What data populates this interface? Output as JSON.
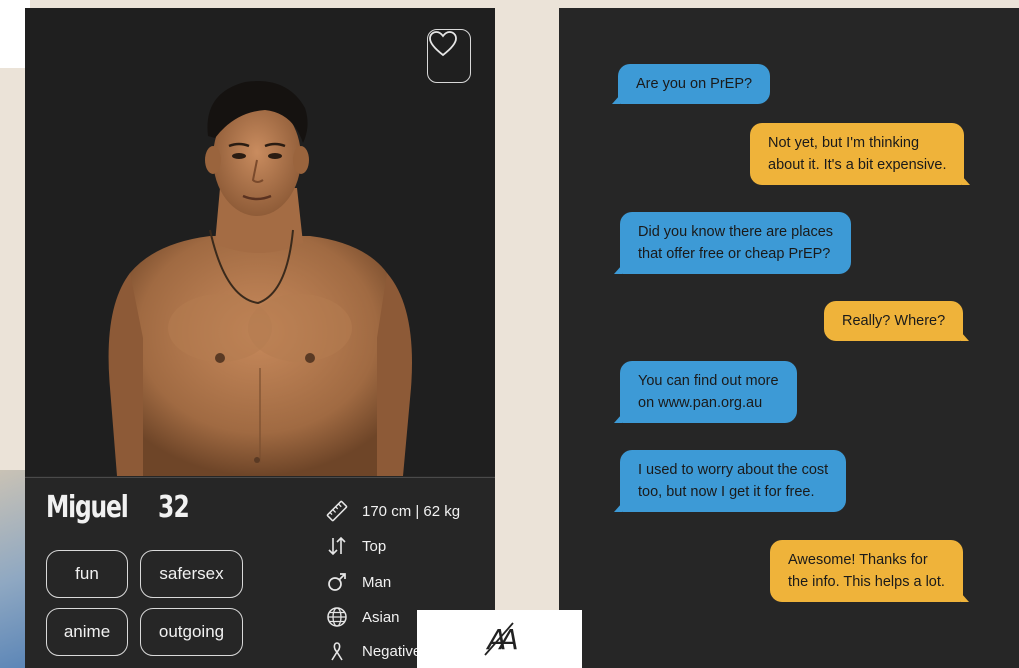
{
  "profile": {
    "name": "Miguel",
    "age": "32",
    "tags": [
      "fun",
      "safersex",
      "anime",
      "outgoing"
    ],
    "stats": [
      {
        "icon": "ruler-icon",
        "text": "170 cm | 62 kg"
      },
      {
        "icon": "position-arrows-icon",
        "text": "Top"
      },
      {
        "icon": "male-symbol-icon",
        "text": "Man"
      },
      {
        "icon": "globe-icon",
        "text": "Asian"
      },
      {
        "icon": "awareness-ribbon-icon",
        "text": "Negative"
      }
    ],
    "favorite_icon": "heart-icon"
  },
  "chat": {
    "messages": [
      {
        "from": "other",
        "lines": [
          "Are you on PrEP?"
        ]
      },
      {
        "from": "me",
        "lines": [
          "Not yet, but I'm thinking",
          "about it. It's a bit expensive."
        ]
      },
      {
        "from": "other",
        "lines": [
          "Did you know there are places",
          "that offer free or cheap PrEP?"
        ]
      },
      {
        "from": "me",
        "lines": [
          "Really? Where?"
        ]
      },
      {
        "from": "other",
        "lines": [
          "You can find out more",
          "on www.pan.org.au"
        ]
      },
      {
        "from": "other",
        "lines": [
          "I used to worry about the cost",
          "too, but now I get it for free."
        ]
      },
      {
        "from": "me",
        "lines": [
          "Awesome! Thanks for",
          "the info. This helps a lot."
        ]
      }
    ]
  },
  "text_size_toggle": {
    "label": "AA",
    "icon": "text-size-icon"
  },
  "colors": {
    "card_bg": "#262626",
    "bubble_blue": "#3d9ad6",
    "bubble_yellow": "#efb33a",
    "page_bg": "#ebe3d8"
  }
}
